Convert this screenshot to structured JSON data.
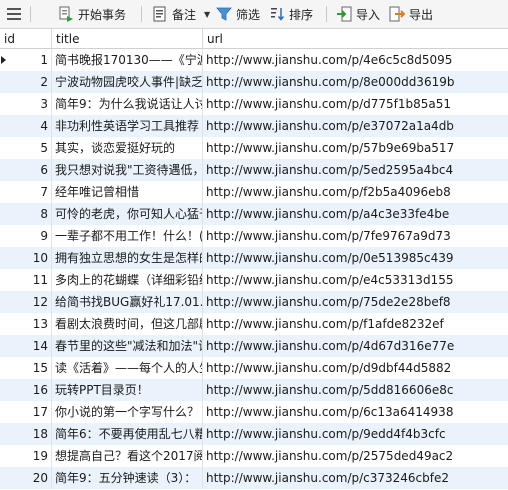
{
  "toolbar": {
    "begin_transaction": "开始事务",
    "remark": "备注",
    "filter": "筛选",
    "sort": "排序",
    "import": "导入",
    "export": "导出"
  },
  "columns": {
    "id": "id",
    "title": "title",
    "url": "url"
  },
  "rows": [
    {
      "id": "1",
      "title": "简书晚报170130——《宁波",
      "url": "http://www.jianshu.com/p/4e6c5c8d5095"
    },
    {
      "id": "2",
      "title": "宁波动物园虎咬人事件|缺乏",
      "url": "http://www.jianshu.com/p/8e000dd3619b"
    },
    {
      "id": "3",
      "title": "简年9：为什么我说话让人讨",
      "url": "http://www.jianshu.com/p/d775f1b85a51"
    },
    {
      "id": "4",
      "title": "非功利性英语学习工具推荐",
      "url": "http://www.jianshu.com/p/e37072a1a4db"
    },
    {
      "id": "5",
      "title": "其实，谈恋爱挺好玩的",
      "url": "http://www.jianshu.com/p/57b9e69ba517"
    },
    {
      "id": "6",
      "title": "我只想对说我\"工资待遇低，",
      "url": "http://www.jianshu.com/p/5ed2595a4bc4"
    },
    {
      "id": "7",
      "title": "经年唯记曾相惜",
      "url": "http://www.jianshu.com/p/f2b5a4096eb8"
    },
    {
      "id": "8",
      "title": "可怜的老虎，你可知人心猛于",
      "url": "http://www.jianshu.com/p/a4c3e33fe4be"
    },
    {
      "id": "9",
      "title": "一辈子都不用工作！什么！(",
      "url": "http://www.jianshu.com/p/7fe9767a9d73"
    },
    {
      "id": "10",
      "title": "拥有独立思想的女生是怎样的",
      "url": "http://www.jianshu.com/p/0e513985c439"
    },
    {
      "id": "11",
      "title": "多肉上的花蝴蝶（详细彩铅绘",
      "url": "http://www.jianshu.com/p/e4c53313d155"
    },
    {
      "id": "12",
      "title": "给简书找BUG赢好礼17.01.2",
      "url": "http://www.jianshu.com/p/75de2e28bef8"
    },
    {
      "id": "13",
      "title": "看剧太浪费时间，但这几部剧",
      "url": "http://www.jianshu.com/p/f1afde8232ef"
    },
    {
      "id": "14",
      "title": "春节里的这些\"减法和加法\"让",
      "url": "http://www.jianshu.com/p/4d67d316e77e"
    },
    {
      "id": "15",
      "title": "读《活着》——每个人的人生",
      "url": "http://www.jianshu.com/p/d9dbf44d5882"
    },
    {
      "id": "16",
      "title": "玩转PPT目录页！",
      "url": "http://www.jianshu.com/p/5dd816606e8c"
    },
    {
      "id": "17",
      "title": "你小说的第一个字写什么？",
      "url": "http://www.jianshu.com/p/6c13a6414938"
    },
    {
      "id": "18",
      "title": "简年6：不要再使用乱七八糟",
      "url": "http://www.jianshu.com/p/9edd4f4b3cfc"
    },
    {
      "id": "19",
      "title": "想提高自己？看这个2017阅",
      "url": "http://www.jianshu.com/p/2575ded49ac2"
    },
    {
      "id": "20",
      "title": "简年9：五分钟速读（3）：",
      "url": "http://www.jianshu.com/p/c373246cbfe2"
    }
  ]
}
